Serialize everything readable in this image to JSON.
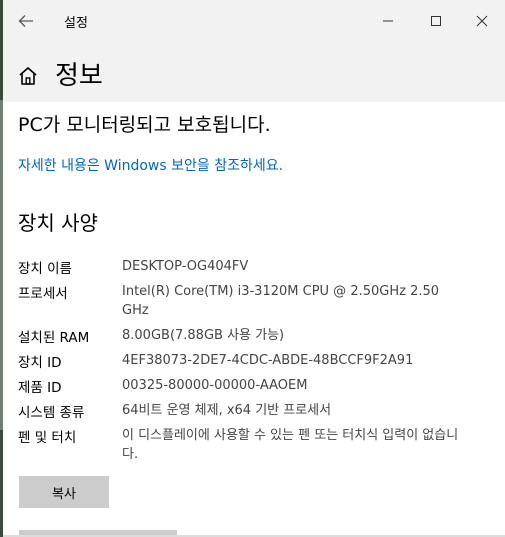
{
  "window": {
    "title": "설정"
  },
  "header": {
    "page_title": "정보"
  },
  "protection": {
    "status_text": "PC가 모니터링되고 보호됩니다.",
    "security_link": "자세한 내용은 Windows 보안을 참조하세요."
  },
  "specs": {
    "section_title": "장치 사양",
    "items": [
      {
        "label": "장치 이름",
        "value": "DESKTOP-OG404FV"
      },
      {
        "label": "프로세서",
        "value": "Intel(R) Core(TM) i3-3120M CPU @ 2.50GHz    2.50 GHz"
      },
      {
        "label": "설치된 RAM",
        "value": "8.00GB(7.88GB 사용 가능)"
      },
      {
        "label": "장치 ID",
        "value": "4EF38073-2DE7-4CDC-ABDE-48BCCF9F2A91"
      },
      {
        "label": "제품 ID",
        "value": "00325-80000-00000-AAOEM"
      },
      {
        "label": "시스템 종류",
        "value": "64비트 운영 체제, x64 기반 프로세서"
      },
      {
        "label": "펜 및 터치",
        "value": "이 디스플레이에 사용할 수 있는 펜 또는 터치식 입력이 없습니다."
      }
    ],
    "copy_label": "복사"
  },
  "icons": {
    "back": "back-arrow-icon",
    "minimize": "minimize-icon",
    "maximize": "maximize-icon",
    "close": "close-icon",
    "home": "home-icon"
  },
  "colors": {
    "titlebar_bg": "#f2f2f2",
    "link": "#0067c0",
    "value_text": "#444444",
    "button_bg": "#cccccc"
  }
}
